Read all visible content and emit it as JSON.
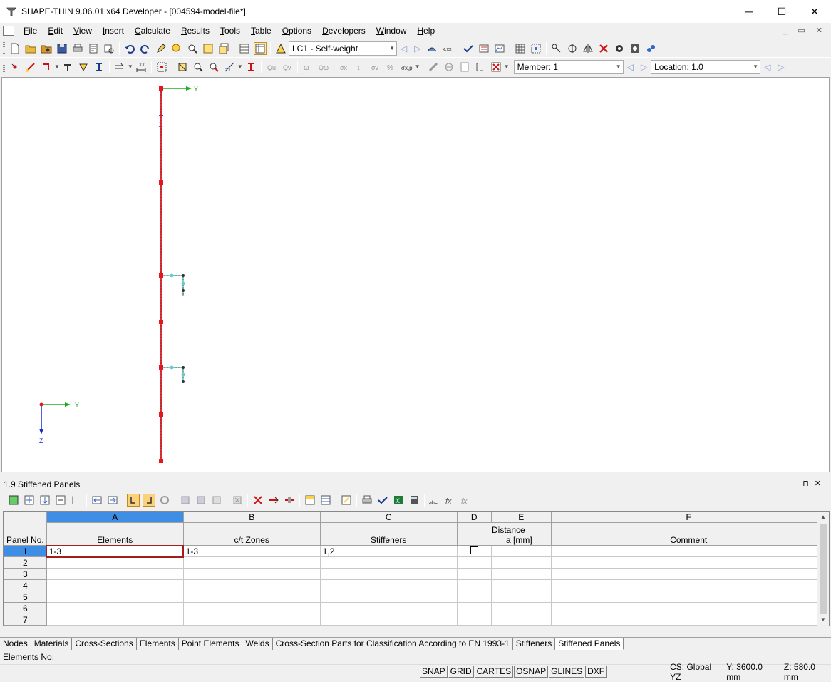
{
  "window": {
    "title": "SHAPE-THIN 9.06.01 x64 Developer - [004594-model-file*]",
    "minimize": "─",
    "maximize": "☐",
    "close": "✕"
  },
  "menu": {
    "items": [
      {
        "u": "F",
        "rest": "ile"
      },
      {
        "u": "E",
        "rest": "dit"
      },
      {
        "u": "V",
        "rest": "iew"
      },
      {
        "u": "I",
        "rest": "nsert"
      },
      {
        "u": "C",
        "rest": "alculate"
      },
      {
        "u": "R",
        "rest": "esults"
      },
      {
        "u": "T",
        "rest": "ools"
      },
      {
        "u": "T",
        "rest": "able"
      },
      {
        "u": "O",
        "rest": "ptions"
      },
      {
        "u": "D",
        "rest": "evelopers"
      },
      {
        "u": "W",
        "rest": "indow"
      },
      {
        "u": "H",
        "rest": "elp"
      }
    ]
  },
  "toolbar": {
    "load_case": "LC1 - Self-weight",
    "member_label": "Member: 1",
    "location_label": "Location:",
    "location_value": "1.0"
  },
  "viewport": {
    "axis_y": "Y",
    "axis_z": "Z",
    "colors": {
      "member": "#e0303a",
      "node_red": "#e8141e",
      "stiffener": "#8ccfcf",
      "axis_y": "#22aa22",
      "axis_z": "#1a2ad0"
    }
  },
  "panel": {
    "title": "1.9 Stiffened Panels",
    "pin": "⊓",
    "close": "✕"
  },
  "table": {
    "letters": [
      "A",
      "B",
      "C",
      "D",
      "E",
      "F"
    ],
    "headers": {
      "panel_no": "Panel No.",
      "elements": "Elements",
      "ct_zones": "c/t Zones",
      "stiffeners": "Stiffeners",
      "distance": "Distance",
      "distance_unit": "a [mm]",
      "comment": "Comment"
    },
    "rows": [
      {
        "no": "1",
        "elements": "1-3",
        "ct": "1-3",
        "stiffeners": "1,2",
        "checkbox": true,
        "distance": "",
        "comment": ""
      },
      {
        "no": "2",
        "elements": "",
        "ct": "",
        "stiffeners": "",
        "checkbox": false,
        "distance": "",
        "comment": ""
      },
      {
        "no": "3",
        "elements": "",
        "ct": "",
        "stiffeners": "",
        "checkbox": false,
        "distance": "",
        "comment": ""
      },
      {
        "no": "4",
        "elements": "",
        "ct": "",
        "stiffeners": "",
        "checkbox": false,
        "distance": "",
        "comment": ""
      },
      {
        "no": "5",
        "elements": "",
        "ct": "",
        "stiffeners": "",
        "checkbox": false,
        "distance": "",
        "comment": ""
      },
      {
        "no": "6",
        "elements": "",
        "ct": "",
        "stiffeners": "",
        "checkbox": false,
        "distance": "",
        "comment": ""
      },
      {
        "no": "7",
        "elements": "",
        "ct": "",
        "stiffeners": "",
        "checkbox": false,
        "distance": "",
        "comment": ""
      }
    ]
  },
  "tabs": [
    "Nodes",
    "Materials",
    "Cross-Sections",
    "Elements",
    "Point Elements",
    "Welds",
    "Cross-Section Parts for Classification According to EN 1993-1",
    "Stiffeners",
    "Stiffened Panels"
  ],
  "active_tab": "Stiffened Panels",
  "status": {
    "hint": "Elements No.",
    "buttons": [
      "SNAP",
      "GRID",
      "CARTES",
      "OSNAP",
      "GLINES",
      "DXF"
    ],
    "cs": "CS: Global YZ",
    "y": "Y:  3600.0 mm",
    "z": "Z:  580.0 mm"
  }
}
